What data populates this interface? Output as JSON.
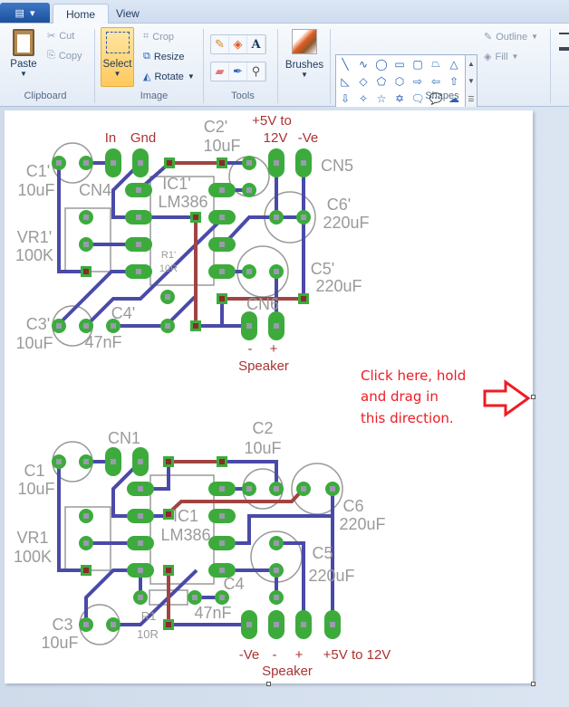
{
  "tabs": {
    "app_menu_icon": "paint-menu-icon",
    "items": [
      {
        "label": "Home",
        "active": true
      },
      {
        "label": "View",
        "active": false
      }
    ]
  },
  "ribbon": {
    "clipboard": {
      "label": "Clipboard",
      "paste": "Paste",
      "cut": "Cut",
      "copy": "Copy"
    },
    "image": {
      "label": "Image",
      "select": "Select",
      "crop": "Crop",
      "resize": "Resize",
      "rotate": "Rotate"
    },
    "tools": {
      "label": "Tools",
      "items": [
        "pencil-icon",
        "fill-icon",
        "text-icon",
        "eraser-icon",
        "color-picker-icon",
        "magnifier-icon"
      ]
    },
    "brushes": {
      "label": "Brushes"
    },
    "shapes": {
      "label": "Shapes",
      "outline": "Outline",
      "fill": "Fill",
      "items": [
        "╲",
        "∿",
        "◯",
        "▭",
        "▢",
        "⏢",
        "△",
        "◺",
        "◇",
        "⬠",
        "⬡",
        "⇨",
        "⇦",
        "⇧",
        "⇩",
        "✧",
        "☆",
        "✡",
        "🗨",
        "💬",
        "☁"
      ]
    }
  },
  "canvas": {
    "colors": {
      "top_trace": "#4a4aa8",
      "bottom_trace": "#a04444",
      "pad": "#3cab3c",
      "silkscreen": "#9a9a9a",
      "annotation": "#ee1c24"
    },
    "top_board": {
      "in": "In",
      "gnd": "Gnd",
      "c2": "C2'",
      "c2_val": "10uF",
      "supply1": "+5V to",
      "supply2": "12V",
      "neg": "-Ve",
      "cn5": "CN5",
      "c1": "C1'",
      "c1_val": "10uF",
      "cn4": "CN4",
      "ic": "IC1'",
      "ic_val": "LM386",
      "c6": "C6'",
      "c6_val": "220uF",
      "vr1": "VR1'",
      "vr1_val": "100K",
      "r1": "R1'",
      "r1_val": "10R",
      "c5": "C5'",
      "c5_val": "220uF",
      "cn6": "CN6",
      "c3": "C3'",
      "c3_val": "10uF",
      "c4": "C4'",
      "c4_val": "47nF",
      "spk_minus": "-",
      "spk_plus": "+",
      "speaker": "Speaker"
    },
    "annotation": {
      "line1": "Click here, hold",
      "line2": "and drag in",
      "line3": "this direction."
    },
    "bottom_board": {
      "cn1": "CN1",
      "c2": "C2",
      "c2_val": "10uF",
      "c1": "C1",
      "c1_val": "10uF",
      "c6": "C6",
      "c6_val": "220uF",
      "ic": "IC1",
      "ic_val": "LM386",
      "vr1": "VR1",
      "vr1_val": "100K",
      "c5": "C5",
      "c5_val": "220uF",
      "c4": "C4",
      "c4_val": "47nF",
      "r1": "R1",
      "r1_val": "10R",
      "c3": "C3",
      "c3_val": "10uF",
      "neg": "-Ve",
      "spk_minus": "-",
      "spk_plus": "+",
      "supply": "+5V to 12V",
      "speaker": "Speaker"
    }
  }
}
